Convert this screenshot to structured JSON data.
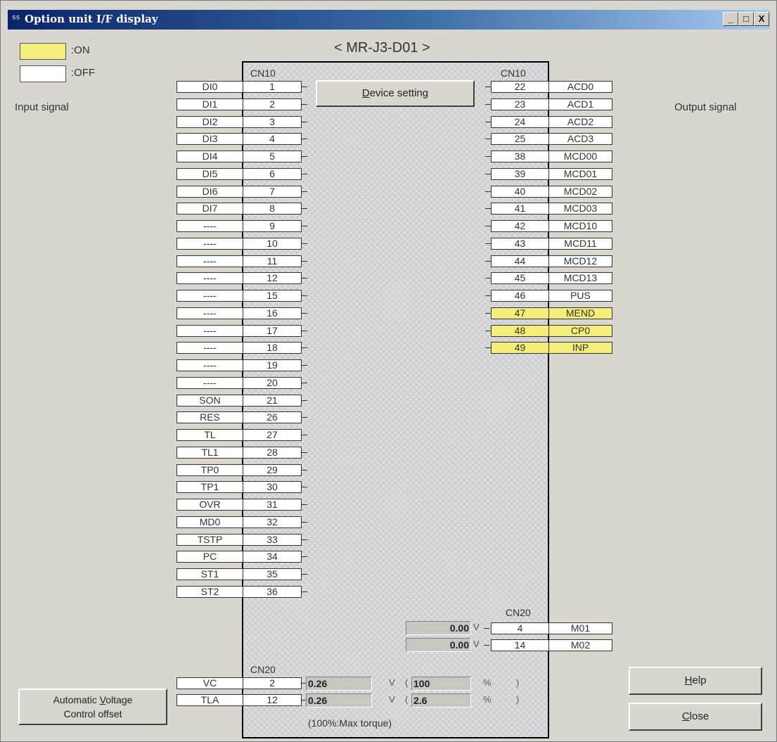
{
  "window": {
    "title": "Option unit I/F display",
    "icon": "app-icon",
    "controls": {
      "minimize": "_",
      "maximize": "□",
      "close": "X"
    }
  },
  "model": "< MR-J3-D01 >",
  "legend": {
    "on_label": ":ON",
    "off_label": ":OFF",
    "on_color": "#f3ef7a",
    "off_color": "#ffffff"
  },
  "input_signal_label": "Input signal",
  "output_signal_label": "Output signal",
  "device_setting_button": {
    "prefix": "",
    "hotkey": "D",
    "suffix": "evice setting"
  },
  "connector_labels": {
    "cn10_left": "CN10",
    "cn10_right": "CN10",
    "cn20_output": "CN20",
    "cn20_analog": "CN20"
  },
  "input_signals": [
    {
      "name": "DI0",
      "pin": "1",
      "on": false
    },
    {
      "name": "DI1",
      "pin": "2",
      "on": false
    },
    {
      "name": "DI2",
      "pin": "3",
      "on": false
    },
    {
      "name": "DI3",
      "pin": "4",
      "on": false
    },
    {
      "name": "DI4",
      "pin": "5",
      "on": false
    },
    {
      "name": "DI5",
      "pin": "6",
      "on": false
    },
    {
      "name": "DI6",
      "pin": "7",
      "on": false
    },
    {
      "name": "DI7",
      "pin": "8",
      "on": false
    },
    {
      "name": "----",
      "pin": "9",
      "on": false
    },
    {
      "name": "----",
      "pin": "10",
      "on": false
    },
    {
      "name": "----",
      "pin": "11",
      "on": false
    },
    {
      "name": "----",
      "pin": "12",
      "on": false
    },
    {
      "name": "----",
      "pin": "15",
      "on": false
    },
    {
      "name": "----",
      "pin": "16",
      "on": false
    },
    {
      "name": "----",
      "pin": "17",
      "on": false
    },
    {
      "name": "----",
      "pin": "18",
      "on": false
    },
    {
      "name": "----",
      "pin": "19",
      "on": false
    },
    {
      "name": "----",
      "pin": "20",
      "on": false
    },
    {
      "name": "SON",
      "pin": "21",
      "on": false
    },
    {
      "name": "RES",
      "pin": "26",
      "on": false
    },
    {
      "name": "TL",
      "pin": "27",
      "on": false
    },
    {
      "name": "TL1",
      "pin": "28",
      "on": false
    },
    {
      "name": "TP0",
      "pin": "29",
      "on": false
    },
    {
      "name": "TP1",
      "pin": "30",
      "on": false
    },
    {
      "name": "OVR",
      "pin": "31",
      "on": false
    },
    {
      "name": "MD0",
      "pin": "32",
      "on": false
    },
    {
      "name": "TSTP",
      "pin": "33",
      "on": false
    },
    {
      "name": "PC",
      "pin": "34",
      "on": false
    },
    {
      "name": "ST1",
      "pin": "35",
      "on": false
    },
    {
      "name": "ST2",
      "pin": "36",
      "on": false
    }
  ],
  "output_signals": [
    {
      "pin": "22",
      "name": "ACD0",
      "on": false
    },
    {
      "pin": "23",
      "name": "ACD1",
      "on": false
    },
    {
      "pin": "24",
      "name": "ACD2",
      "on": false
    },
    {
      "pin": "25",
      "name": "ACD3",
      "on": false
    },
    {
      "pin": "38",
      "name": "MCD00",
      "on": false
    },
    {
      "pin": "39",
      "name": "MCD01",
      "on": false
    },
    {
      "pin": "40",
      "name": "MCD02",
      "on": false
    },
    {
      "pin": "41",
      "name": "MCD03",
      "on": false
    },
    {
      "pin": "42",
      "name": "MCD10",
      "on": false
    },
    {
      "pin": "43",
      "name": "MCD11",
      "on": false
    },
    {
      "pin": "44",
      "name": "MCD12",
      "on": false
    },
    {
      "pin": "45",
      "name": "MCD13",
      "on": false
    },
    {
      "pin": "46",
      "name": "PUS",
      "on": false
    },
    {
      "pin": "47",
      "name": "MEND",
      "on": true
    },
    {
      "pin": "48",
      "name": "CP0",
      "on": true
    },
    {
      "pin": "49",
      "name": "INP",
      "on": true
    }
  ],
  "analog_outputs": [
    {
      "value": "0.00",
      "unit": "V",
      "pin": "4",
      "name": "M01"
    },
    {
      "value": "0.00",
      "unit": "V",
      "pin": "14",
      "name": "M02"
    }
  ],
  "analog_inputs": [
    {
      "name": "VC",
      "pin": "2",
      "voltage": "0.26",
      "unit": "V",
      "open": "(",
      "percent": "100",
      "pct_unit": "%",
      "close": ")"
    },
    {
      "name": "TLA",
      "pin": "12",
      "voltage": "0.26",
      "unit": "V",
      "open": "(",
      "percent": "2.6",
      "pct_unit": "%",
      "close": ")"
    }
  ],
  "torque_note": "(100%:Max torque)",
  "buttons": {
    "auto_voltage": {
      "line1_prefix": "Automatic ",
      "line1_hotkey": "V",
      "line1_suffix": "oltage",
      "line2": "Control offset"
    },
    "help": {
      "hotkey": "H",
      "rest": "elp"
    },
    "close": {
      "hotkey": "C",
      "rest": "lose"
    }
  }
}
